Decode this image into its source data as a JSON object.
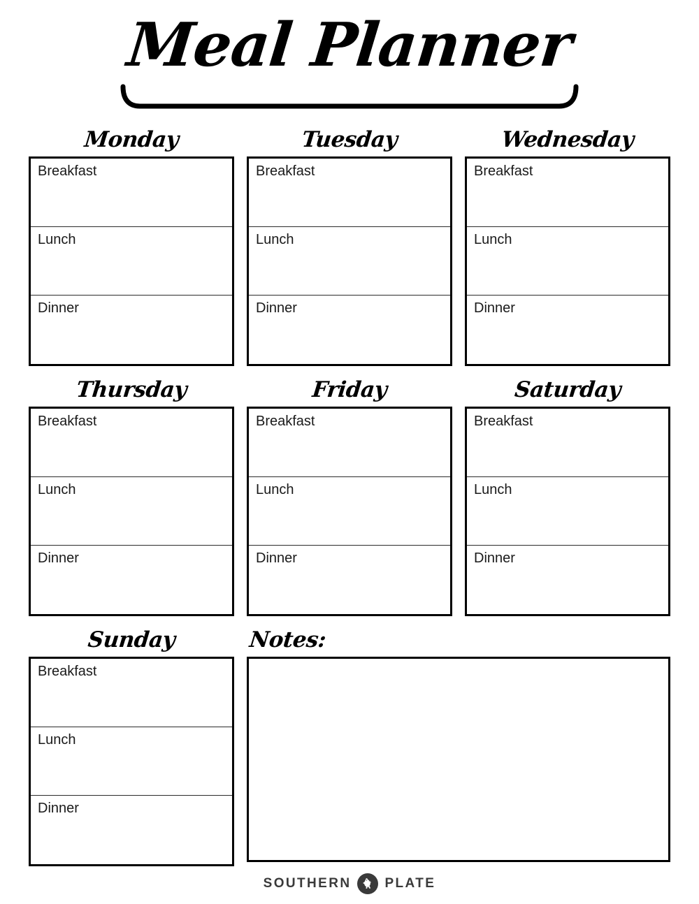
{
  "page": {
    "title": "Meal Planner",
    "notes_label": "Notes:"
  },
  "meals": {
    "breakfast": "Breakfast",
    "lunch": "Lunch",
    "dinner": "Dinner"
  },
  "days": [
    {
      "name": "Monday",
      "meals": [
        "Breakfast",
        "Lunch",
        "Dinner"
      ]
    },
    {
      "name": "Tuesday",
      "meals": [
        "Breakfast",
        "Lunch",
        "Dinner"
      ]
    },
    {
      "name": "Wednesday",
      "meals": [
        "Breakfast",
        "Lunch",
        "Dinner"
      ]
    },
    {
      "name": "Thursday",
      "meals": [
        "Breakfast",
        "Lunch",
        "Dinner"
      ]
    },
    {
      "name": "Friday",
      "meals": [
        "Breakfast",
        "Lunch",
        "Dinner"
      ]
    },
    {
      "name": "Saturday",
      "meals": [
        "Breakfast",
        "Lunch",
        "Dinner"
      ]
    },
    {
      "name": "Sunday",
      "meals": [
        "Breakfast",
        "Lunch",
        "Dinner"
      ]
    }
  ],
  "footer": {
    "word_left": "SOUTHERN",
    "word_right": "PLATE",
    "icon": "rooster-icon"
  },
  "colors": {
    "ink": "#000000",
    "divider": "#2b2b2b",
    "paper": "#ffffff",
    "footer_gray": "#3a3a3a"
  }
}
